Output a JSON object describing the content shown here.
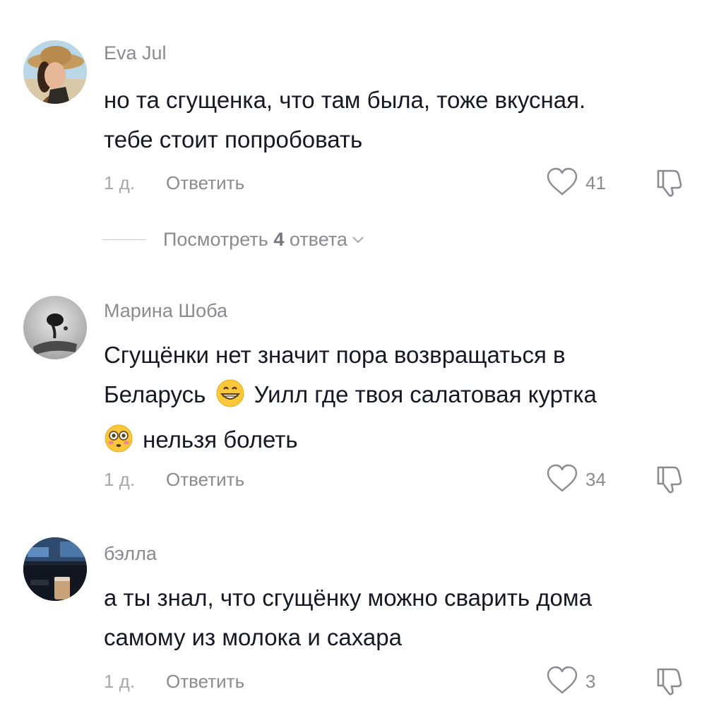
{
  "comments": [
    {
      "username": "Eva Jul",
      "text_lines": [
        "но та сгущенка, что там была, тоже вкусная.",
        "тебе стоит попробовать"
      ],
      "time": "1 д.",
      "reply_label": "Ответить",
      "likes": "41",
      "like_icon": "heart-outline-icon",
      "dislike_icon": "thumbs-down-icon",
      "view_replies": {
        "prefix": "Посмотреть ",
        "count": "4",
        "suffix": " ответа"
      }
    },
    {
      "username": "Марина Шоба",
      "text_line1": "Сгущёнки нет значит пора возвращаться в",
      "text_line2_a": "Беларусь",
      "emoji1": "grinning-face-emoji",
      "text_line2_b": "Уилл где твоя салатовая куртка",
      "emoji2": "flushed-face-emoji",
      "text_line3": "нельзя болеть",
      "time": "1 д.",
      "reply_label": "Ответить",
      "likes": "34"
    },
    {
      "username": "бэлла",
      "text_lines": [
        "а ты знал, что сгущёнку можно сварить дома",
        "самому из молока и сахара"
      ],
      "time": "1 д.",
      "reply_label": "Ответить",
      "likes": "3"
    }
  ],
  "colors": {
    "username": "#8a8b91",
    "text": "#161823",
    "meta": "#a7a8ad"
  }
}
